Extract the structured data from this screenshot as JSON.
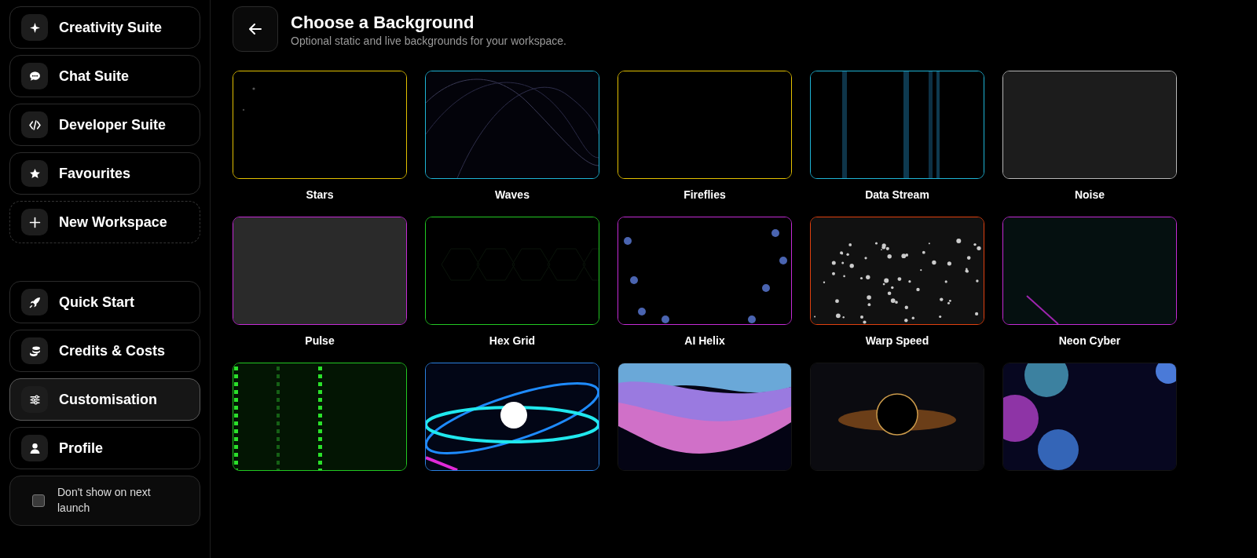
{
  "sidebar": {
    "top_items": [
      {
        "label": "Creativity Suite",
        "kind": "sparkle",
        "selected": false
      },
      {
        "label": "Chat Suite",
        "kind": "chat",
        "selected": false
      },
      {
        "label": "Developer Suite",
        "kind": "code",
        "selected": false
      },
      {
        "label": "Favourites",
        "kind": "star",
        "selected": false
      },
      {
        "label": "New Workspace",
        "kind": "plus",
        "selected": false
      }
    ],
    "bottom_items": [
      {
        "label": "Quick Start",
        "kind": "rocket",
        "selected": false
      },
      {
        "label": "Credits & Costs",
        "kind": "coins",
        "selected": false
      },
      {
        "label": "Customisation",
        "kind": "sliders",
        "selected": true
      },
      {
        "label": "Profile",
        "kind": "person",
        "selected": false
      }
    ],
    "dont_show": {
      "label": "Don't show on next launch",
      "checked": false
    }
  },
  "header": {
    "title": "Choose a Background",
    "subtitle": "Optional static and live backgrounds for your workspace."
  },
  "backgrounds": [
    {
      "label": "Stars",
      "kind": "stars",
      "color": "#e3c100"
    },
    {
      "label": "Waves",
      "kind": "waves",
      "color": "#1eb4d6"
    },
    {
      "label": "Fireflies",
      "kind": "fireflies",
      "color": "#e3c100"
    },
    {
      "label": "Data Stream",
      "kind": "stream",
      "color": "#1eb4d6"
    },
    {
      "label": "Noise",
      "kind": "noise",
      "color": "#b8b8b8"
    },
    {
      "label": "Pulse",
      "kind": "pulse",
      "color": "#c42bd6"
    },
    {
      "label": "Hex Grid",
      "kind": "hex",
      "color": "#22c922"
    },
    {
      "label": "AI Helix",
      "kind": "helix",
      "color": "#c42bd6"
    },
    {
      "label": "Warp Speed",
      "kind": "warp",
      "color": "#e0410f"
    },
    {
      "label": "Neon Cyber",
      "kind": "neon",
      "color": "#c42bd6"
    },
    {
      "kind": "grid",
      "color": "#22c922"
    },
    {
      "kind": "orb",
      "color": "#2a80e0"
    },
    {
      "kind": "aurora"
    },
    {
      "kind": "blackhole"
    },
    {
      "kind": "plasma"
    }
  ]
}
